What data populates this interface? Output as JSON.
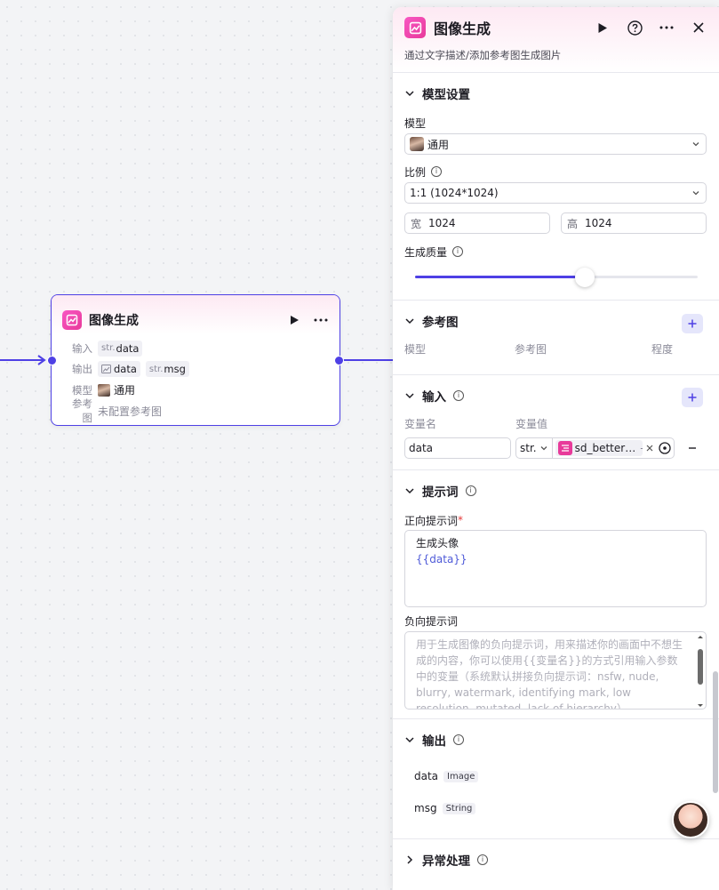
{
  "node": {
    "title": "图像生成",
    "rows": {
      "input_key": "输入",
      "input_type": "str.",
      "input_name": "data",
      "output_key": "输出",
      "output_1": "data",
      "output_2_type": "str.",
      "output_2": "msg",
      "model_key": "模型",
      "model_value": "通用",
      "ref_key": "参考图",
      "ref_value": "未配置参考图"
    }
  },
  "panel": {
    "title": "图像生成",
    "description": "通过文字描述/添加参考图生成图片",
    "model_settings": {
      "title": "模型设置",
      "model_label": "模型",
      "model_value": "通用",
      "ratio_label": "比例",
      "ratio_value": "1:1 (1024*1024)",
      "width_key": "宽",
      "width_value": "1024",
      "height_key": "高",
      "height_value": "1024",
      "quality_label": "生成质量",
      "quality_fraction": 0.6
    },
    "reference": {
      "title": "参考图",
      "col_model": "模型",
      "col_image": "参考图",
      "col_degree": "程度"
    },
    "inputs": {
      "title": "输入",
      "col_name": "变量名",
      "col_value": "变量值",
      "var_name": "data",
      "var_type": "str.",
      "var_ref": "sd_better…",
      "var_ref_sep": "-"
    },
    "prompt": {
      "title": "提示词",
      "positive_label": "正向提示词",
      "required_mark": "*",
      "positive_line1": "生成头像",
      "positive_line2": "{{data}}",
      "negative_label": "负向提示词",
      "negative_placeholder": "用于生成图像的负向提示词，用来描述你的画面中不想生成的内容，你可以使用{{变量名}}的方式引用输入参数中的变量（系统默认拼接负向提示词：nsfw, nude, blurry, watermark, identifying mark, low resolution, mutated, lack of hierarchy）"
    },
    "outputs": {
      "title": "输出",
      "items": [
        {
          "name": "data",
          "type": "Image"
        },
        {
          "name": "msg",
          "type": "String"
        }
      ]
    },
    "exception": {
      "title": "异常处理"
    }
  },
  "colors": {
    "accent": "#4e40e5",
    "app_icon": "#e83a9a"
  }
}
